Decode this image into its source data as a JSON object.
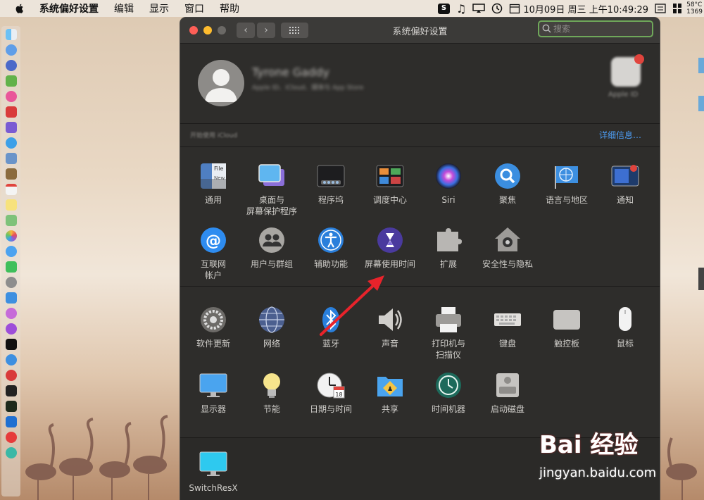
{
  "menubar": {
    "app_name": "系统偏好设置",
    "menus": [
      "编辑",
      "显示",
      "窗口",
      "帮助"
    ],
    "datetime": "10月09日 周三 上午10:49:29",
    "temp_line1": "58°C",
    "temp_line2": "1369"
  },
  "window": {
    "title": "系统偏好设置",
    "search_placeholder": "搜索",
    "back": "‹",
    "forward": "›"
  },
  "user": {
    "name": "Tyrone Gaddy",
    "subtitle": "Apple ID、iCloud、媒体与 App Store",
    "apple_id_label": "Apple ID",
    "icloud_note": "开始使用 iCloud",
    "details_link": "详细信息…"
  },
  "panes_row1": [
    {
      "label": "通用",
      "icon": "general-icon"
    },
    {
      "label": "桌面与\n屏幕保护程序",
      "icon": "desktop-screensaver-icon"
    },
    {
      "label": "程序坞",
      "icon": "dock-icon"
    },
    {
      "label": "调度中心",
      "icon": "mission-control-icon"
    },
    {
      "label": "Siri",
      "icon": "siri-icon"
    },
    {
      "label": "聚焦",
      "icon": "spotlight-icon"
    },
    {
      "label": "语言与地区",
      "icon": "language-region-icon"
    },
    {
      "label": "通知",
      "icon": "notifications-icon"
    }
  ],
  "panes_row2": [
    {
      "label": "互联网\n帐户",
      "icon": "internet-accounts-icon"
    },
    {
      "label": "用户与群组",
      "icon": "users-groups-icon"
    },
    {
      "label": "辅助功能",
      "icon": "accessibility-icon"
    },
    {
      "label": "屏幕使用时间",
      "icon": "screen-time-icon"
    },
    {
      "label": "扩展",
      "icon": "extensions-icon"
    },
    {
      "label": "安全性与隐私",
      "icon": "security-privacy-icon"
    }
  ],
  "panes_row3": [
    {
      "label": "软件更新",
      "icon": "software-update-icon"
    },
    {
      "label": "网络",
      "icon": "network-icon"
    },
    {
      "label": "蓝牙",
      "icon": "bluetooth-icon"
    },
    {
      "label": "声音",
      "icon": "sound-icon"
    },
    {
      "label": "打印机与\n扫描仪",
      "icon": "printers-scanners-icon"
    },
    {
      "label": "键盘",
      "icon": "keyboard-icon"
    },
    {
      "label": "触控板",
      "icon": "trackpad-icon"
    },
    {
      "label": "鼠标",
      "icon": "mouse-icon"
    }
  ],
  "panes_row4": [
    {
      "label": "显示器",
      "icon": "displays-icon"
    },
    {
      "label": "节能",
      "icon": "energy-saver-icon"
    },
    {
      "label": "日期与时间",
      "icon": "date-time-icon"
    },
    {
      "label": "共享",
      "icon": "sharing-icon"
    },
    {
      "label": "时间机器",
      "icon": "time-machine-icon"
    },
    {
      "label": "启动磁盘",
      "icon": "startup-disk-icon"
    }
  ],
  "panes_other": [
    {
      "label": "SwitchResX",
      "icon": "switchresx-icon"
    }
  ],
  "colors": {
    "accent_link": "#4d9df5",
    "annotation_arrow": "#e8232b",
    "close": "#fe5f57",
    "minimize": "#febc2e"
  },
  "watermark": {
    "brand": "Bai 经验",
    "url": "jingyan.baidu.com"
  }
}
